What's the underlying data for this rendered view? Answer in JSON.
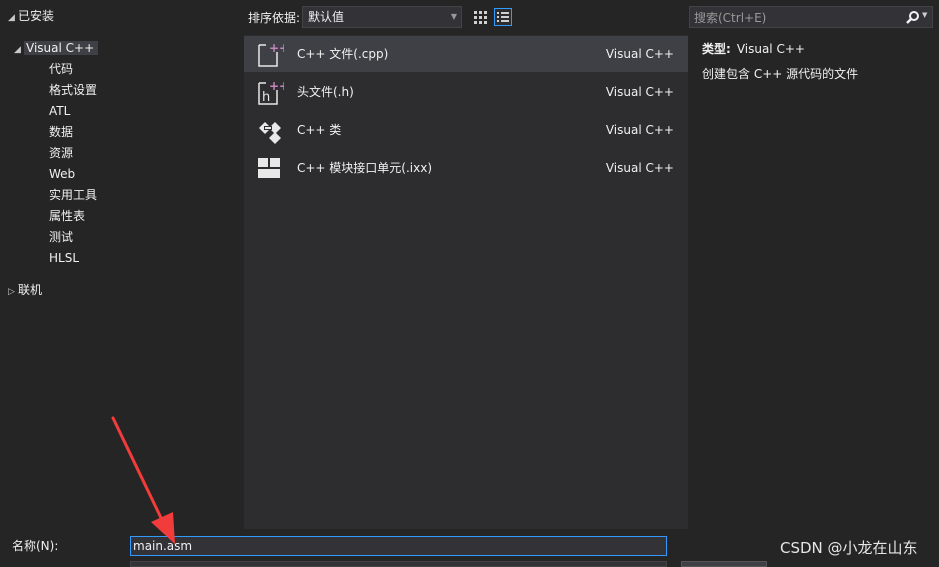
{
  "tree": {
    "installed": "已安装",
    "visual_cpp": "Visual C++",
    "children": [
      "代码",
      "格式设置",
      "ATL",
      "数据",
      "资源",
      "Web",
      "实用工具",
      "属性表",
      "测试",
      "HLSL"
    ],
    "online": "联机"
  },
  "toolbar": {
    "sort_label": "排序依据:",
    "sort_value": "默认值"
  },
  "search": {
    "placeholder": "搜索(Ctrl+E)"
  },
  "templates": [
    {
      "name": "C++ 文件(.cpp)",
      "lang": "Visual C++",
      "icon": "cpp-file-icon"
    },
    {
      "name": "头文件(.h)",
      "lang": "Visual C++",
      "icon": "header-file-icon"
    },
    {
      "name": "C++ 类",
      "lang": "Visual C++",
      "icon": "cpp-class-icon"
    },
    {
      "name": "C++ 模块接口单元(.ixx)",
      "lang": "Visual C++",
      "icon": "module-unit-icon"
    }
  ],
  "details": {
    "type_label": "类型:",
    "type_value": "Visual C++",
    "description": "创建包含 C++ 源代码的文件"
  },
  "footer": {
    "name_label": "名称(N):",
    "name_value": "main.asm"
  },
  "watermark": "CSDN @小龙在山东",
  "colors": {
    "accent": "#3399ff",
    "icon_plus": "#c586c0",
    "arrow": "#f23c3c"
  }
}
